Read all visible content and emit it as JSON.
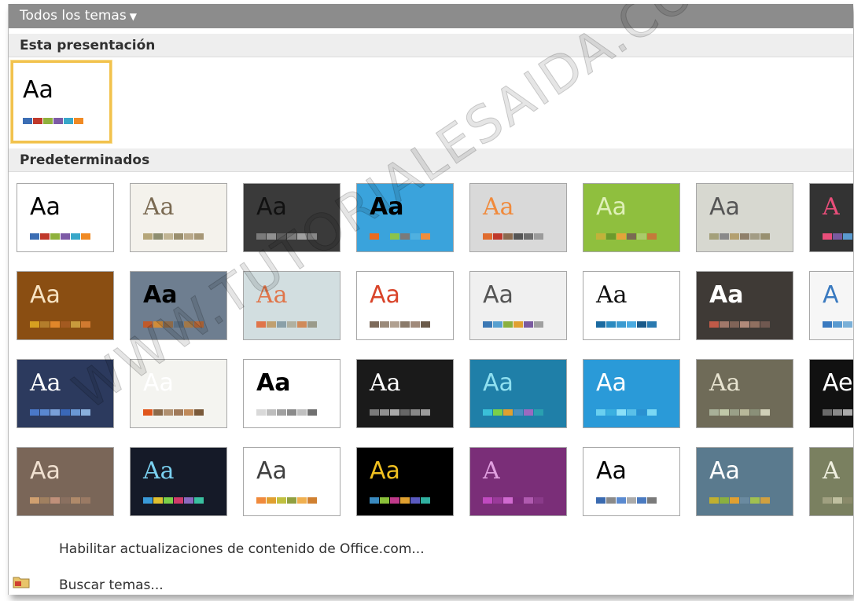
{
  "header": {
    "title": "Todos los temas"
  },
  "sections": {
    "this_presentation": "Esta presentación",
    "defaults": "Predeterminados"
  },
  "current_theme": {
    "preview_text": "Aa",
    "swatches": [
      "#3c6eb4",
      "#c0392b",
      "#8fb13c",
      "#7d5aa6",
      "#38a7c9",
      "#f08a24"
    ]
  },
  "themes": [
    {
      "text": "Aa",
      "bg": "#ffffff",
      "fg": "#000000",
      "swatches": [
        "#3c6eb4",
        "#c0392b",
        "#8fb13c",
        "#7d5aa6",
        "#38a7c9",
        "#f08a24"
      ]
    },
    {
      "text": "Aa",
      "bg": "#f4f2ec",
      "fg": "#7a6a52",
      "swatches": [
        "#b6a77a",
        "#8e8e70",
        "#c1b594",
        "#9a8f6e",
        "#b8a889",
        "#a69776"
      ]
    },
    {
      "text": "Aa",
      "bg": "#3a3a3a",
      "fg": "#111111",
      "swatches": [
        "#7a7a7a",
        "#909090",
        "#5e5e5e",
        "#7c7c7c",
        "#a0a0a0",
        "#888888"
      ]
    },
    {
      "text": "Aa",
      "bg": "#3aa3dc",
      "fg": "#000000",
      "swatches": [
        "#e96b1f",
        "#3aa3dc",
        "#8bc34a",
        "#7a7a7a",
        "#4fb0e0",
        "#ef8d3a"
      ]
    },
    {
      "text": "Aa",
      "bg": "#d9d9d9",
      "fg": "#f08a3c",
      "swatches": [
        "#e06c2f",
        "#c0392b",
        "#8b6a4f",
        "#555555",
        "#6d6d6d",
        "#9b9b9b"
      ]
    },
    {
      "text": "Aa",
      "bg": "#8fbf3e",
      "fg": "#dff0b8",
      "swatches": [
        "#c2b23a",
        "#6b9a2c",
        "#e3a43a",
        "#7a6a52",
        "#aacb6a",
        "#c47a3a"
      ]
    },
    {
      "text": "Aa",
      "bg": "#d7d8d0",
      "fg": "#555555",
      "swatches": [
        "#a4a07a",
        "#8a8a8a",
        "#b3a070",
        "#8f806a",
        "#a29c84",
        "#989070"
      ]
    },
    {
      "text": "A",
      "bg": "#333333",
      "fg": "#e94e7a",
      "swatches": [
        "#e94e7a",
        "#7a5aa0",
        "#5a9ad0",
        "#e9a03c",
        "#58b070",
        "#888888"
      ]
    },
    {
      "text": "Aa",
      "bg": "#8a4e12",
      "fg": "#f7e3c2",
      "swatches": [
        "#d6a020",
        "#b37d2c",
        "#e0862a",
        "#a35a20",
        "#c89a3c",
        "#d07a30"
      ]
    },
    {
      "text": "Aa",
      "bg": "#6e7e90",
      "fg": "#000000",
      "swatches": [
        "#c05a2a",
        "#d08c3a",
        "#8c6a4a",
        "#5a6e82",
        "#a0784a",
        "#b86a3a"
      ]
    },
    {
      "text": "Aa",
      "bg": "#d2dee0",
      "fg": "#e0754a",
      "swatches": [
        "#e0754a",
        "#c0a070",
        "#8aa0a8",
        "#b0b0a0",
        "#d08a5a",
        "#9a9a8a"
      ]
    },
    {
      "text": "Aa",
      "bg": "#ffffff",
      "fg": "#d9442a",
      "swatches": [
        "#7d6a5a",
        "#9a8a7a",
        "#b0a090",
        "#8a7a6a",
        "#a08a7a",
        "#6a5a4a"
      ]
    },
    {
      "text": "Aa",
      "bg": "#f0f0f0",
      "fg": "#555555",
      "swatches": [
        "#3c78b4",
        "#58a0d0",
        "#8ab040",
        "#e0a030",
        "#7a5aa0",
        "#a0a0a0"
      ]
    },
    {
      "text": "Aa",
      "bg": "#ffffff",
      "fg": "#111111",
      "swatches": [
        "#1a6aa0",
        "#2a8ac0",
        "#3a9ad0",
        "#4aaae0",
        "#1a5a8a",
        "#2a7ab0"
      ]
    },
    {
      "text": "Aa",
      "bg": "#3f3a36",
      "fg": "#ffffff",
      "swatches": [
        "#c05a48",
        "#a0786a",
        "#806458",
        "#b08a7a",
        "#907060",
        "#705850"
      ]
    },
    {
      "text": "A",
      "bg": "#f6f6f6",
      "fg": "#3a7ac0",
      "swatches": [
        "#3a7ac0",
        "#5a9ad0",
        "#7ab0d8",
        "#4a88c4",
        "#6aa0d0",
        "#8ab8de"
      ]
    },
    {
      "text": "Aa",
      "bg": "#2c3a5e",
      "fg": "#ffffff",
      "swatches": [
        "#4a78c8",
        "#5a88d0",
        "#7aa0d8",
        "#3a68b8",
        "#6a98d4",
        "#8ab0dc"
      ]
    },
    {
      "text": "Aa",
      "bg": "#f4f4f0",
      "fg": "#ffffff",
      "swatches": [
        "#e0561c",
        "#8a6a4a",
        "#b09070",
        "#a07a5a",
        "#c08a5a",
        "#7a5a3a"
      ]
    },
    {
      "text": "Aa",
      "bg": "#ffffff",
      "fg": "#000000",
      "swatches": [
        "#d9d9d9",
        "#bdbdbd",
        "#a0a0a0",
        "#8a8a8a",
        "#c0c0c0",
        "#707070"
      ]
    },
    {
      "text": "Aa",
      "bg": "#1a1a1a",
      "fg": "#ffffff",
      "swatches": [
        "#7a7a7a",
        "#909090",
        "#a8a8a8",
        "#666666",
        "#888888",
        "#9c9c9c"
      ]
    },
    {
      "text": "Aa",
      "bg": "#1f7fa8",
      "fg": "#8fe0f0",
      "swatches": [
        "#3ac0d8",
        "#7ad04a",
        "#e0a030",
        "#4a90c0",
        "#9a6ac0",
        "#2aa0b0"
      ]
    },
    {
      "text": "Aa",
      "bg": "#2a9ad8",
      "fg": "#ffffff",
      "swatches": [
        "#6ad0f0",
        "#3ab0e0",
        "#8ae0f8",
        "#5ac0e8",
        "#2a90d0",
        "#7ad8f4"
      ]
    },
    {
      "text": "Aa",
      "bg": "#6f6b58",
      "fg": "#e8e4d0",
      "swatches": [
        "#a8b098",
        "#c0c8a8",
        "#9aa088",
        "#b8b89a",
        "#8a9078",
        "#d0d0b8"
      ]
    },
    {
      "text": "Ae",
      "bg": "#111111",
      "fg": "#ffffff",
      "swatches": [
        "#6a6a6a",
        "#8a8a8a",
        "#aaaaaa",
        "#5a5a5a",
        "#7a7a7a",
        "#9a9a9a"
      ]
    },
    {
      "text": "Aa",
      "bg": "#7a6658",
      "fg": "#f0e0d0",
      "swatches": [
        "#d0a070",
        "#a08060",
        "#c0907a",
        "#8a7060",
        "#b08a6a",
        "#9a7a64"
      ]
    },
    {
      "text": "Aa",
      "bg": "#151a28",
      "fg": "#7ad0f0",
      "swatches": [
        "#3a9ad8",
        "#e0c030",
        "#7ad04a",
        "#d03a6a",
        "#8a6ac0",
        "#3ac0a0"
      ]
    },
    {
      "text": "Aa",
      "bg": "#ffffff",
      "fg": "#404040",
      "swatches": [
        "#f08a3c",
        "#e0a030",
        "#c0c040",
        "#90a040",
        "#f0b050",
        "#d08030"
      ]
    },
    {
      "text": "Aa",
      "bg": "#000000",
      "fg": "#f0c020",
      "swatches": [
        "#3a8ac0",
        "#8ac03a",
        "#c03a8a",
        "#e0a030",
        "#5a5ac0",
        "#30b0a0"
      ]
    },
    {
      "text": "A",
      "bg": "#7a2e78",
      "fg": "#e0a0e0",
      "swatches": [
        "#c04ac0",
        "#9a3a9a",
        "#d06ad0",
        "#7a2a7a",
        "#b05ab0",
        "#8a3a8a"
      ]
    },
    {
      "text": "Aa",
      "bg": "#ffffff",
      "fg": "#000000",
      "swatches": [
        "#3a6ab0",
        "#8a8a8a",
        "#5a8ad0",
        "#aaaaaa",
        "#4a7ac0",
        "#7a7a7a"
      ]
    },
    {
      "text": "Aa",
      "bg": "#5a7a8e",
      "fg": "#ffffff",
      "swatches": [
        "#c0b030",
        "#8ab040",
        "#e0a030",
        "#6a8aa0",
        "#a0c050",
        "#d0a040"
      ]
    },
    {
      "text": "A",
      "bg": "#7a8060",
      "fg": "#f0f0e0",
      "swatches": [
        "#a0a080",
        "#c0c0a0",
        "#8a8a6a",
        "#b0b090",
        "#909070",
        "#d0d0b0"
      ]
    }
  ],
  "bottom": {
    "office_updates": "Habilitar actualizaciones de contenido de Office.com...",
    "search_themes": "Buscar temas..."
  },
  "watermark": "WWW.TUTORIALESAIDA.COM"
}
